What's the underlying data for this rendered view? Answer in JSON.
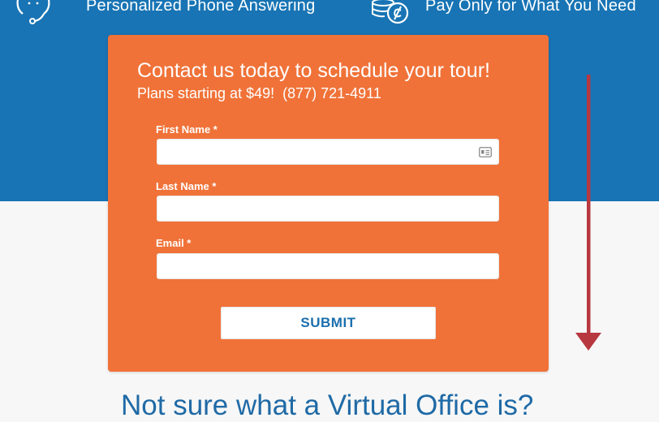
{
  "features": [
    {
      "label": "Personalized Phone Answering",
      "icon": "headset-icon"
    },
    {
      "label": "Pay Only for What You Need",
      "icon": "coins-icon"
    }
  ],
  "form": {
    "title": "Contact us today to schedule your tour!",
    "plans_text": "Plans starting at $49!",
    "phone": "(877) 721-4911",
    "fields": [
      {
        "label": "First Name *",
        "value": "",
        "placeholder": ""
      },
      {
        "label": "Last Name *",
        "value": "",
        "placeholder": ""
      },
      {
        "label": "Email *",
        "value": "",
        "placeholder": ""
      }
    ],
    "submit_label": "SUBMIT"
  },
  "section_heading": "Not sure what a Virtual Office is?",
  "colors": {
    "blue_band": "#1874b4",
    "form_orange": "#f07238",
    "accent_blue": "#1c6fae",
    "arrow_red": "#b8383f",
    "page_bg": "#f7f7f7"
  }
}
